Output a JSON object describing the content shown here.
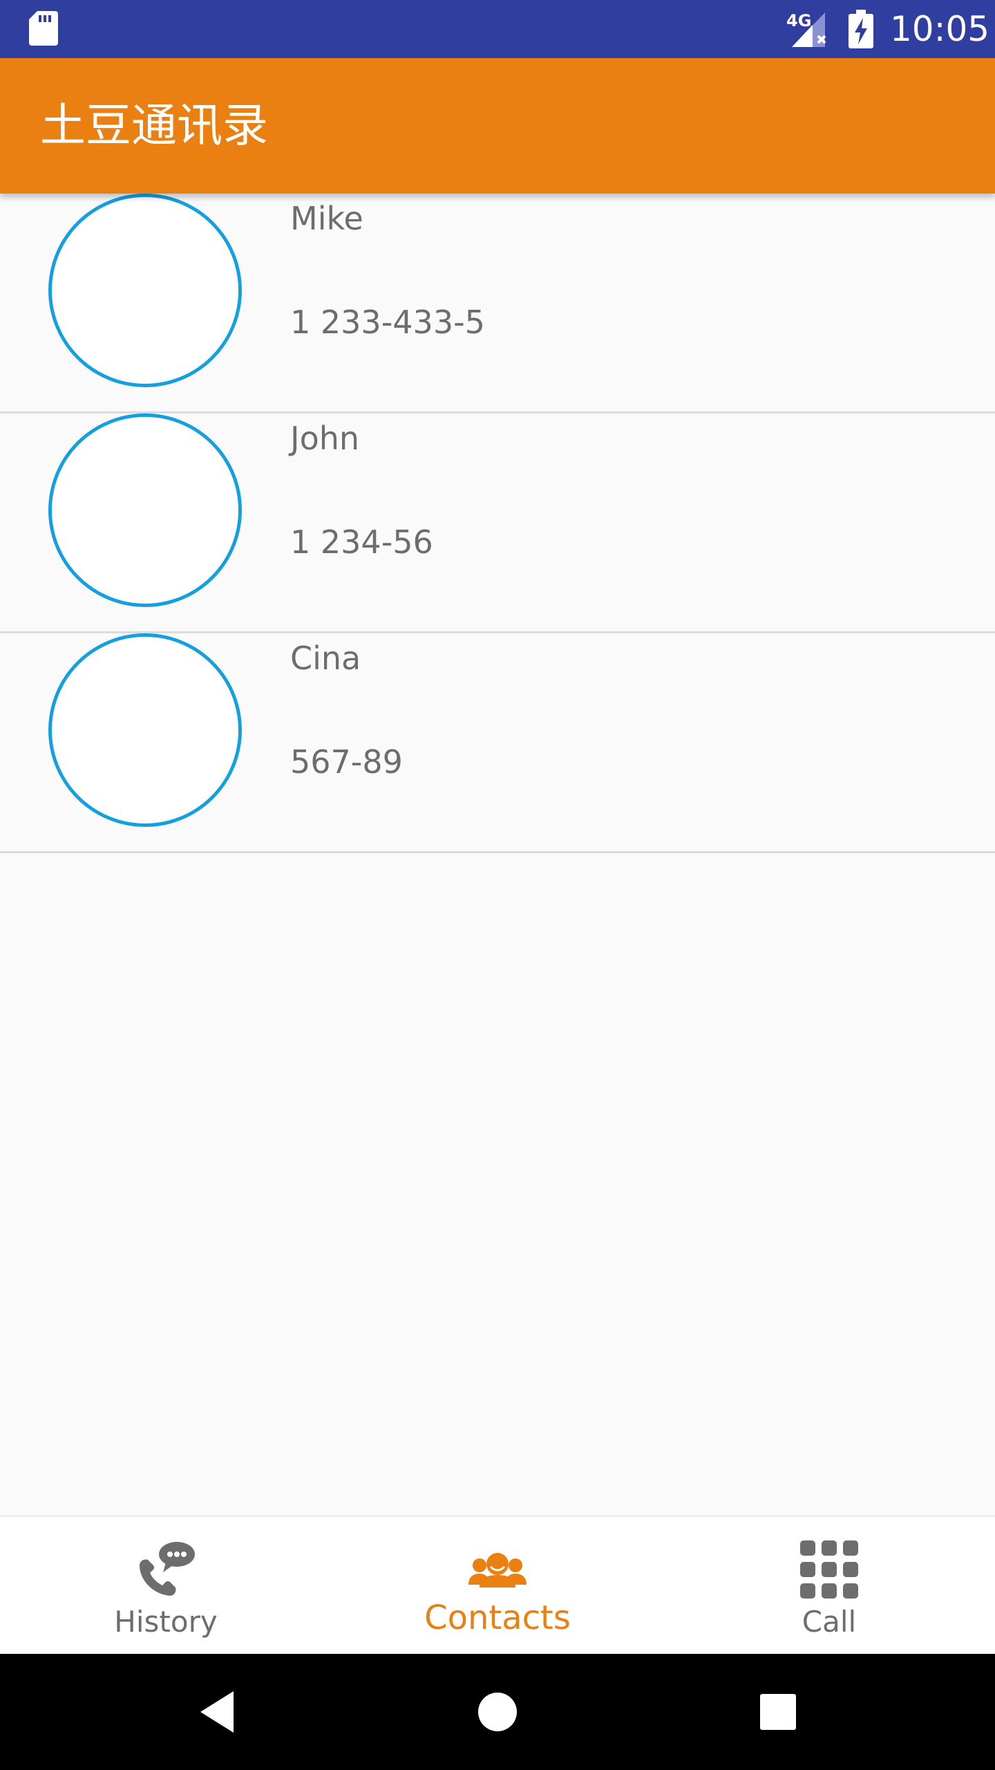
{
  "status_bar": {
    "network": "4G",
    "time": "10:05",
    "icons": [
      "sd-card-icon",
      "signal-icon",
      "battery-charging-icon"
    ]
  },
  "app_bar": {
    "title": "土豆通讯录",
    "color": "#e98011"
  },
  "contacts": [
    {
      "name": "Mike",
      "phone": "1 233-433-5"
    },
    {
      "name": "John",
      "phone": "1 234-56"
    },
    {
      "name": "Cina",
      "phone": "567-89"
    }
  ],
  "bottom_nav": {
    "items": [
      {
        "label": "History",
        "icon": "phone-chat-icon",
        "active": false
      },
      {
        "label": "Contacts",
        "icon": "contacts-icon",
        "active": true
      },
      {
        "label": "Call",
        "icon": "dialpad-icon",
        "active": false
      }
    ],
    "active_color": "#e98011",
    "inactive_color": "#6d6d6d"
  },
  "system_nav": {
    "icons": [
      "back-icon",
      "home-icon",
      "recents-icon"
    ]
  },
  "colors": {
    "status_bar": "#303f9f",
    "avatar_ring": "#149fe0"
  }
}
